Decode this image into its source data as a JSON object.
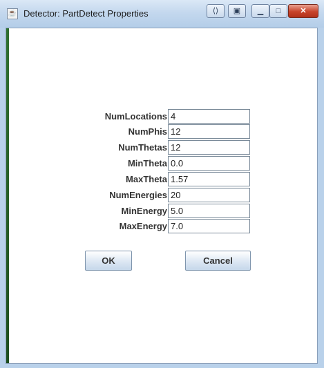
{
  "window": {
    "title": "Detector: PartDetect Properties",
    "icon": "java-app-icon",
    "controls": [
      "swap-icon",
      "restore-icon",
      "minimize-icon",
      "maximize-icon",
      "close-icon"
    ]
  },
  "form": {
    "fields": [
      {
        "label": "NumLocations",
        "value": "4"
      },
      {
        "label": "NumPhis",
        "value": "12"
      },
      {
        "label": "NumThetas",
        "value": "12"
      },
      {
        "label": "MinTheta",
        "value": "0.0"
      },
      {
        "label": "MaxTheta",
        "value": "1.57"
      },
      {
        "label": "NumEnergies",
        "value": "20"
      },
      {
        "label": "MinEnergy",
        "value": "5.0"
      },
      {
        "label": "MaxEnergy",
        "value": "7.0"
      }
    ]
  },
  "buttons": {
    "ok": "OK",
    "cancel": "Cancel"
  },
  "colors": {
    "titlebar": "#c4d8ee",
    "close": "#c7432a",
    "text": "#333333"
  }
}
